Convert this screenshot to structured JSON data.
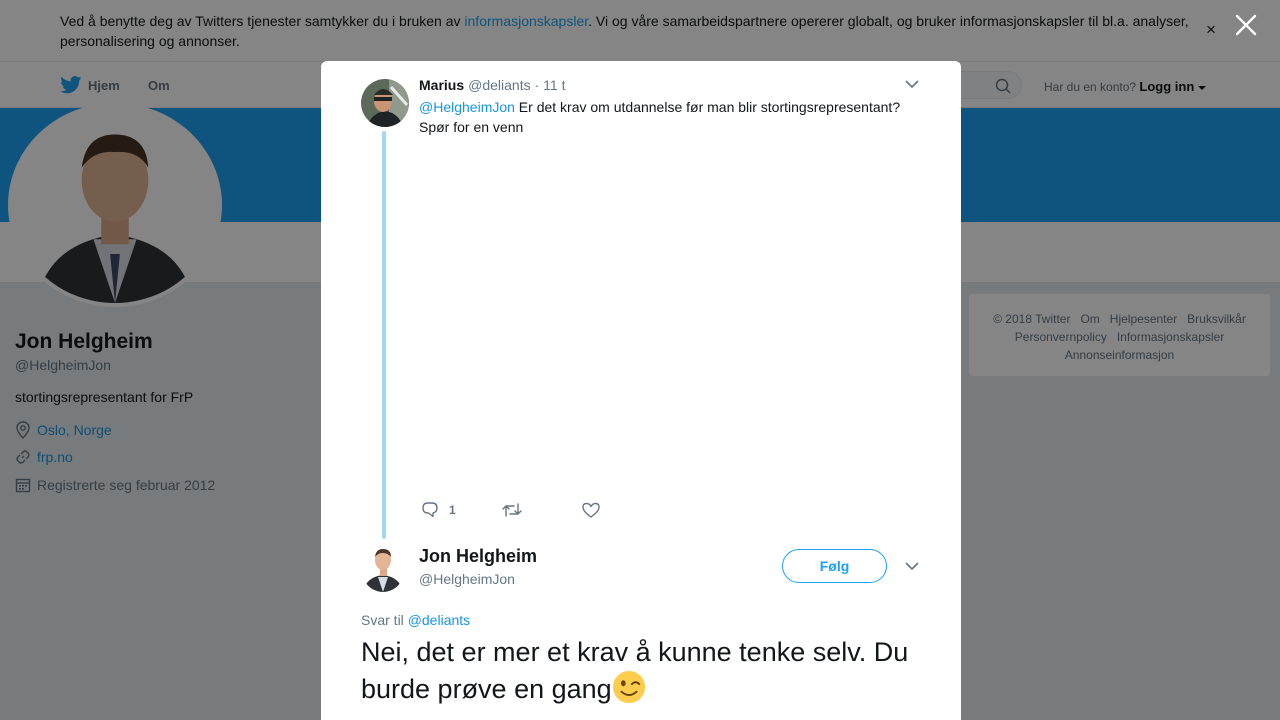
{
  "cookie_banner": {
    "text_before": "Ved å benytte deg av Twitters tjenester samtykker du i bruken av ",
    "link_text": "informasjonskapsler",
    "text_after": ". Vi og våre samarbeidspartnere opererer globalt, og bruker informasjonskapsler til bl.a. analyser, personalisering og annonser.",
    "close_glyph": "×"
  },
  "nav": {
    "home_label": "Hjem",
    "about_label": "Om",
    "login_prompt": "Har du en konto?",
    "login_label": "Logg inn"
  },
  "profile": {
    "name": "Jon Helgheim",
    "handle": "@HelgheimJon",
    "bio": "stortingsrepresentant for FrP",
    "location": "Oslo, Norge",
    "website": "frp.no",
    "joined": "Registrerte seg februar 2012"
  },
  "footer": {
    "links_row1": [
      "© 2018 Twitter",
      "Om",
      "Hjelpesenter",
      "Bruksvilkår"
    ],
    "links_row2": [
      "Personvernpolicy",
      "Informasjonskapsler"
    ],
    "links_row3": [
      "Annonseinformasjon"
    ]
  },
  "parent_tweet": {
    "author_name": "Marius",
    "author_handle": "@deliants",
    "time": "· 11 t",
    "mention": "@HelgheimJon",
    "text": " Er det krav om utdannelse før man blir stortingsrepresentant? Spør for en venn",
    "reply_count": "1"
  },
  "main_tweet": {
    "author_name": "Jon Helgheim",
    "author_handle": "@HelgheimJon",
    "follow_label": "Følg",
    "reply_to_prefix": "Svar til ",
    "reply_to_handle": "@deliants",
    "text": "Nei, det er mer et krav å kunne tenke selv. Du burde prøve en gang",
    "emoji": "winking-face"
  },
  "colors": {
    "accent": "#1da1f2",
    "link": "#1b95e0",
    "thread_line": "#a5d6f6",
    "muted": "#657786"
  }
}
